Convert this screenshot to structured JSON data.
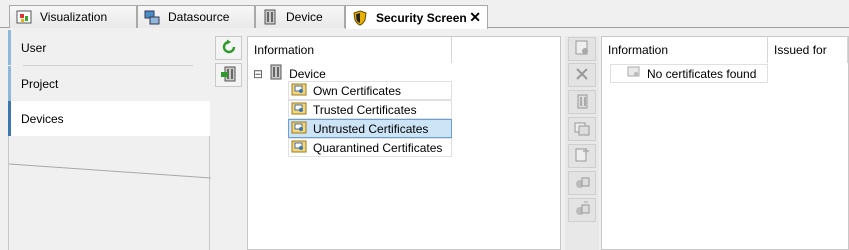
{
  "tabs": [
    {
      "label": "Visualization",
      "icon": "visualization-icon"
    },
    {
      "label": "Datasource",
      "icon": "datasource-icon"
    },
    {
      "label": "Device",
      "icon": "device-icon"
    },
    {
      "label": "Security Screen",
      "icon": "security-shield-icon",
      "active": true
    }
  ],
  "close_glyph": "✕",
  "nav": {
    "items": [
      {
        "label": "User"
      },
      {
        "label": "Project"
      },
      {
        "label": "Devices",
        "active": true
      }
    ]
  },
  "tree": {
    "header": "Information",
    "root": {
      "expander": "⊟",
      "label": "Device"
    },
    "children": [
      {
        "label": "Own Certificates"
      },
      {
        "label": "Trusted Certificates"
      },
      {
        "label": "Untrusted Certificates",
        "selected": true
      },
      {
        "label": "Quarantined Certificates"
      }
    ]
  },
  "list": {
    "headers": [
      "Information",
      "Issued for"
    ],
    "empty_message": "No certificates found"
  },
  "colors": {
    "accent": "#3c78b0",
    "selection": "#cde4f7",
    "refresh_green": "#2e9a2e"
  }
}
